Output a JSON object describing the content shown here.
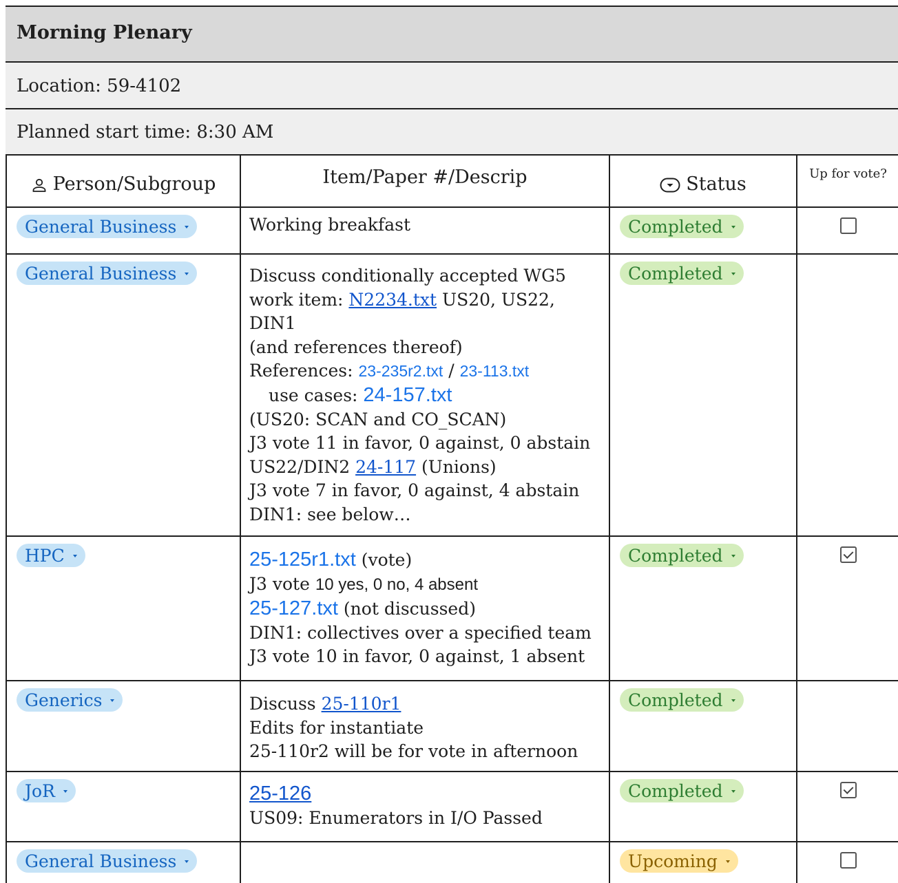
{
  "title": "Morning Plenary",
  "location": "Location: 59-4102",
  "start_time": "Planned start time: 8:30 AM",
  "icons": {
    "person": "person-icon",
    "status": "dropdown-chip-icon",
    "caret": "caret-down-icon"
  },
  "columns": {
    "person": "Person/Subgroup",
    "item": "Item/Paper #/Descrip",
    "status": "Status",
    "vote": "Up for vote?"
  },
  "rows": [
    {
      "person": "General Business",
      "status": "Completed",
      "vote": "unchecked",
      "item": {
        "line1": "Working breakfast"
      }
    },
    {
      "person": "General Business",
      "status": "Completed",
      "vote": "none",
      "item": {
        "l1": "Discuss conditionally accepted WG5",
        "l2_pre": "work item: ",
        "l2_link": "N2234.txt",
        "l2_post": " US20, US22, DIN1",
        "l3": "(and references thereof)",
        "l4_pre": "References: ",
        "l4_link1": "23-235r2.txt",
        "l4_sep": " / ",
        "l4_link2": "23-113.txt",
        "l5_pre": "use cases: ",
        "l5_link": "24-157.txt",
        "l6": "(US20: SCAN and CO_SCAN)",
        "l7": "J3 vote 11 in favor, 0 against, 0 abstain",
        "l8_pre": "US22/DIN2 ",
        "l8_link": "24-117",
        "l8_post": " (Unions)",
        "l9": "J3 vote 7 in favor, 0 against, 4 abstain",
        "l10": "DIN1: see below…"
      }
    },
    {
      "person": "HPC",
      "status": "Completed",
      "vote": "checked",
      "item": {
        "l1_link": "25-125r1.txt",
        "l1_post": " (vote)",
        "l2_pre": "J3 vote ",
        "l2_sans": "10 yes, 0 no, 4 absent",
        "l3_link": "25-127.txt",
        "l3_post": " (not discussed)",
        "l4": "DIN1: collectives over a specified team",
        "l5": "J3 vote 10 in favor, 0 against, 1 absent"
      }
    },
    {
      "person": "Generics",
      "status": "Completed",
      "vote": "none",
      "item": {
        "l1_pre": "Discuss ",
        "l1_link": "25-110r1",
        "l2": "Edits for instantiate",
        "l3": "25-110r2 will be for vote in afternoon"
      }
    },
    {
      "person": "JoR",
      "status": "Completed",
      "vote": "checked",
      "item": {
        "l1_link": "25-126",
        "l2": "US09: Enumerators in I/O Passed"
      }
    },
    {
      "person": "General Business",
      "status": "Upcoming",
      "vote": "unchecked",
      "item": {}
    }
  ],
  "colors": {
    "person_chip_bg": "#c6e3f7",
    "person_chip_text": "#1565c0",
    "completed_bg": "#d4edbc",
    "completed_text": "#2e7d32",
    "upcoming_bg": "#ffe5a0",
    "upcoming_text": "#8a6100",
    "link": "#1a73e8",
    "title_band": "#d9d9d9",
    "info_band": "#efefef"
  }
}
